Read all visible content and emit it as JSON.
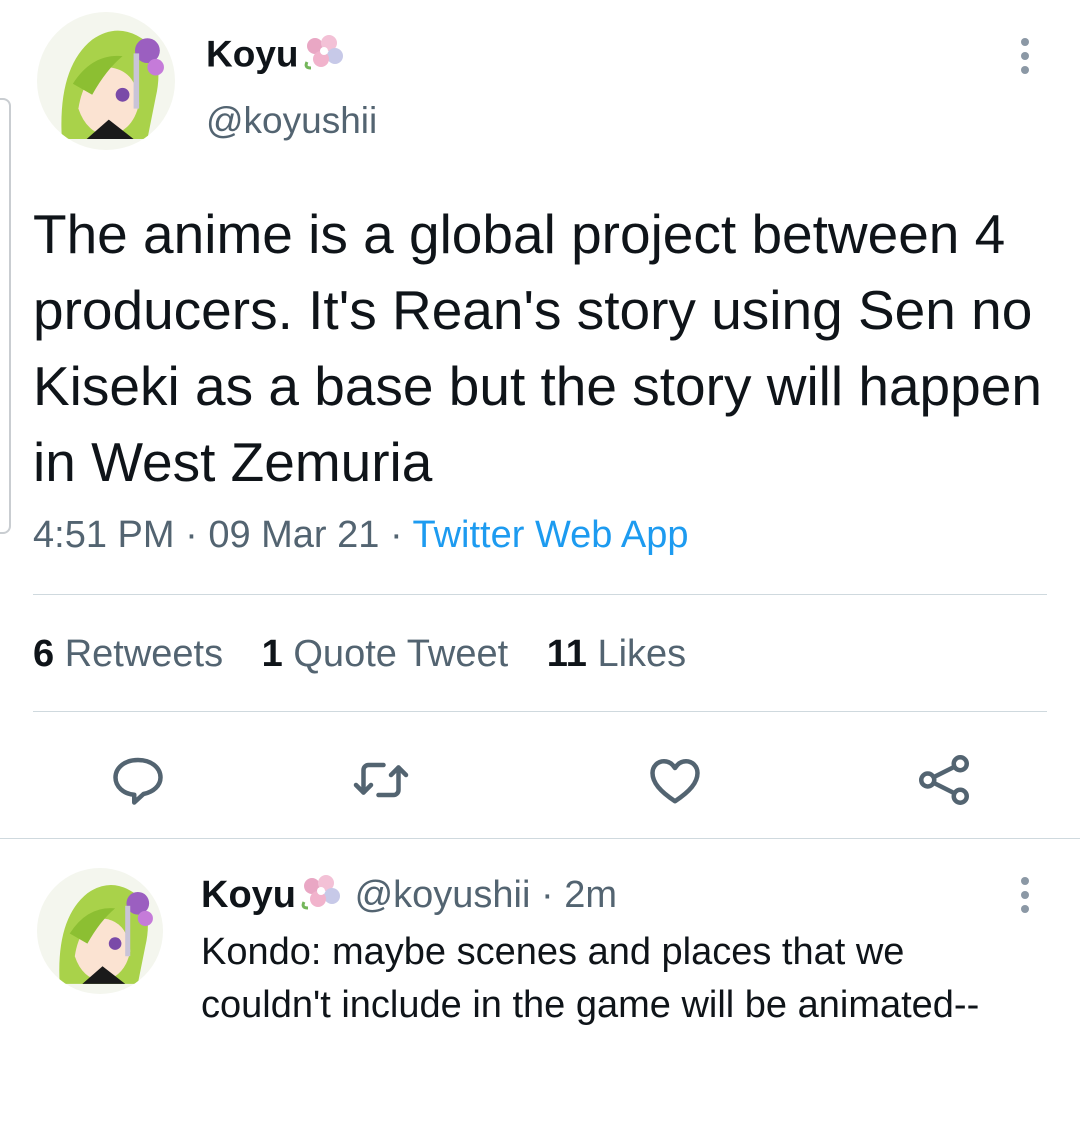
{
  "tweet": {
    "author": {
      "display_name": "Koyu",
      "handle": "@koyushii",
      "avatar_icon": "avatar-anime-character"
    },
    "text": "The anime is a global project between 4 producers. It's Rean's story using Sen no Kiseki as a base but the story will happen in West Zemuria",
    "time": "4:51 PM",
    "date": "09 Mar 21",
    "source": "Twitter Web App",
    "separator": " · ",
    "stats": {
      "retweets_count": "6",
      "retweets_label": "Retweets",
      "quotes_count": "1",
      "quotes_label": "Quote Tweet",
      "likes_count": "11",
      "likes_label": "Likes"
    },
    "actions": [
      "reply-icon",
      "retweet-icon",
      "like-icon",
      "share-icon"
    ]
  },
  "reply": {
    "display_name": "Koyu",
    "handle": "@koyushii",
    "separator": " · ",
    "time_ago": "2m",
    "text": "Kondo: maybe scenes and places that we couldn't include in the game will be animated--"
  },
  "colors": {
    "text": "#0f1419",
    "secondary": "#536471",
    "link": "#1d9bf0",
    "divider": "#cfd9de"
  }
}
